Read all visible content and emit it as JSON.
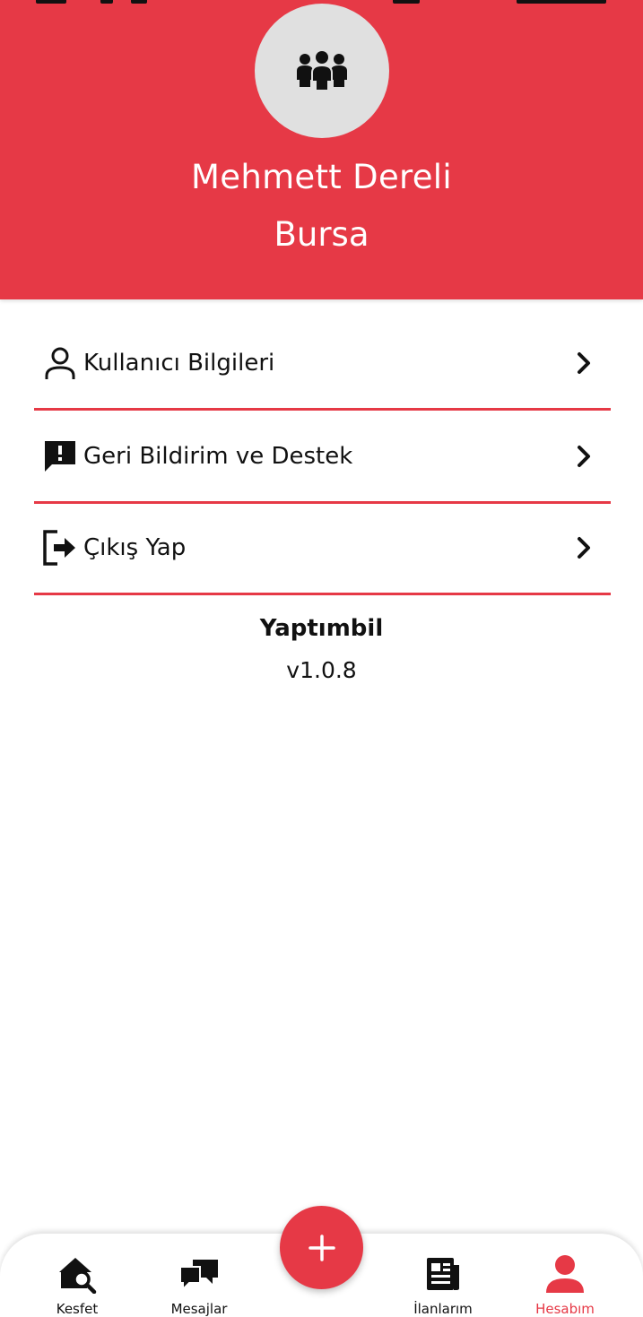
{
  "profile": {
    "name": "Mehmett Dereli",
    "city": "Bursa",
    "avatar_icon": "users-group-icon"
  },
  "menu": {
    "items": [
      {
        "label": "Kullanıcı Bilgileri",
        "icon": "user-icon"
      },
      {
        "label": "Geri Bildirim ve Destek",
        "icon": "feedback-icon"
      },
      {
        "label": "Çıkış Yap",
        "icon": "logout-icon"
      }
    ]
  },
  "app": {
    "name": "Yaptımbil",
    "version": "v1.0.8"
  },
  "bottom_nav": {
    "items": [
      {
        "label": "Kesfet",
        "icon": "home-search-icon",
        "active": false
      },
      {
        "label": "Mesajlar",
        "icon": "chat-icon",
        "active": false
      },
      {
        "label": "İlanlarım",
        "icon": "newspaper-icon",
        "active": false
      },
      {
        "label": "Hesabım",
        "icon": "person-icon",
        "active": true
      }
    ],
    "fab_icon": "plus-icon"
  },
  "colors": {
    "accent": "#e63946",
    "avatar_bg": "#e0e0e0"
  }
}
